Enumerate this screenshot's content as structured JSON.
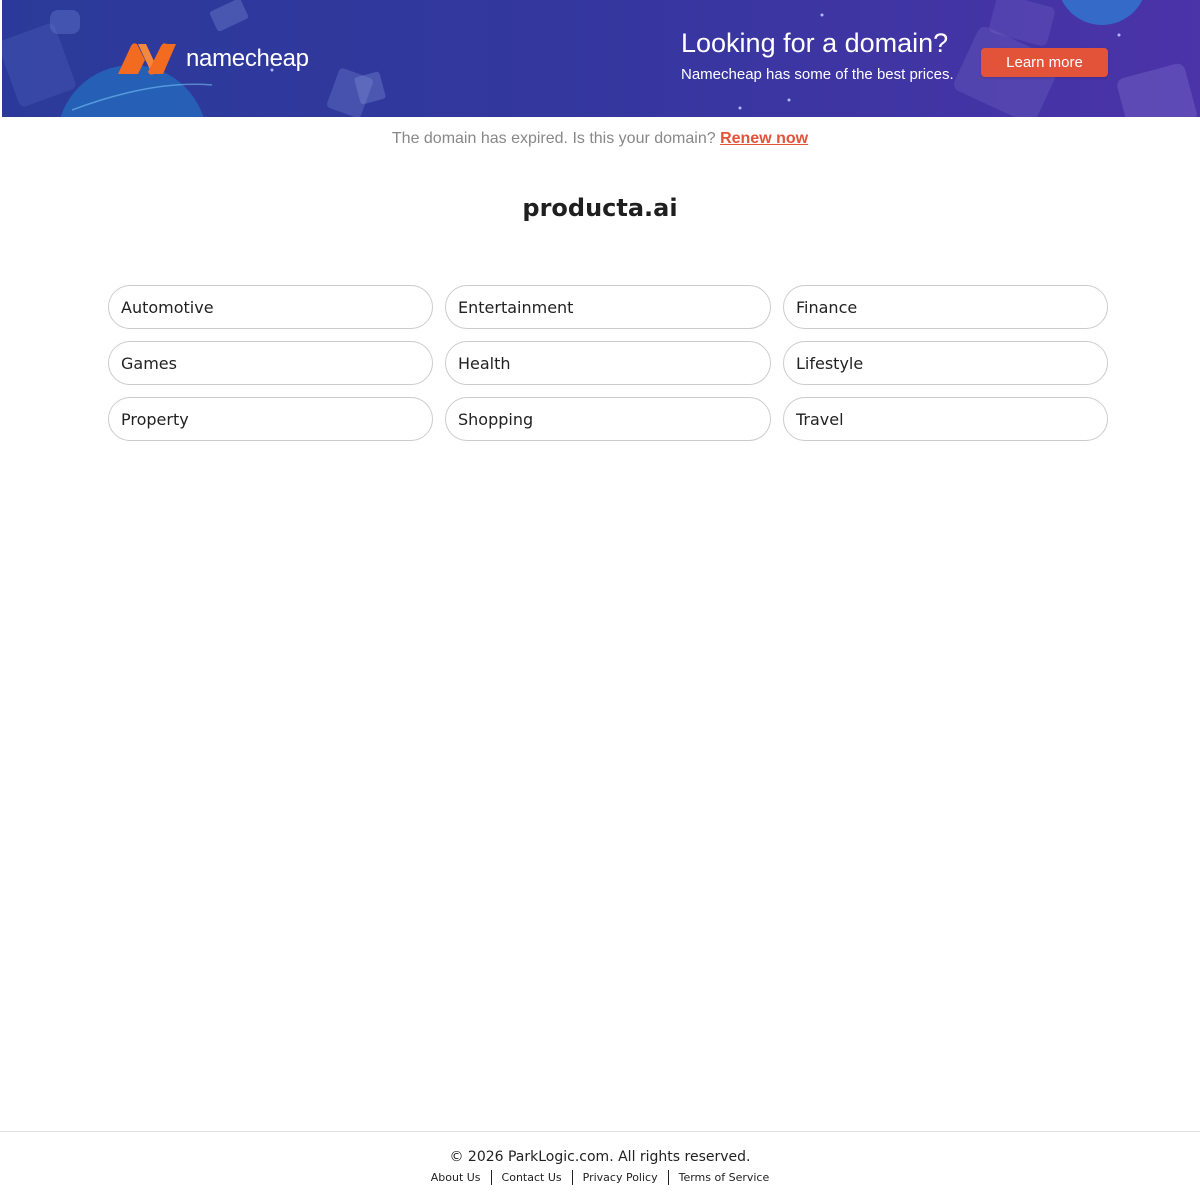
{
  "banner": {
    "logo_text": "namecheap",
    "logo_icon": "namecheap-n-logo",
    "promo_title": "Looking for a domain?",
    "promo_subtitle": "Namecheap has some of the best prices.",
    "cta_label": "Learn more",
    "colors": {
      "background_start": "#2b3a9a",
      "background_end": "#4b33a8",
      "accent": "#e2533a",
      "logo_orange": "#f26b21"
    }
  },
  "notice": {
    "text": "The domain has expired. Is this your domain?",
    "renew_label": "Renew now"
  },
  "domain": {
    "name": "producta.ai"
  },
  "categories": [
    {
      "label": "Automotive"
    },
    {
      "label": "Entertainment"
    },
    {
      "label": "Finance"
    },
    {
      "label": "Games"
    },
    {
      "label": "Health"
    },
    {
      "label": "Lifestyle"
    },
    {
      "label": "Property"
    },
    {
      "label": "Shopping"
    },
    {
      "label": "Travel"
    }
  ],
  "footer": {
    "copyright": "© 2026 ParkLogic.com. All rights reserved.",
    "links": [
      {
        "label": "About Us"
      },
      {
        "label": "Contact Us"
      },
      {
        "label": "Privacy Policy"
      },
      {
        "label": "Terms of Service"
      }
    ]
  }
}
